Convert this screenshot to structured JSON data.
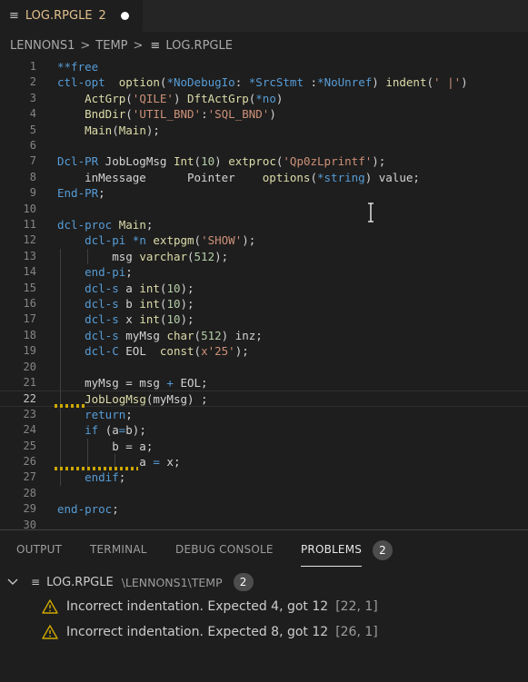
{
  "tab": {
    "icon": "menu-lines-icon",
    "name": "LOG.RPGLE",
    "count": "2",
    "unsaved_dot": "modified-dot-icon"
  },
  "breadcrumb": {
    "parts": [
      "LENNONS1",
      "TEMP",
      "LOG.RPGLE"
    ],
    "separator": ">"
  },
  "editor": {
    "current_line": 22,
    "lines": [
      {
        "num": "1",
        "tokens": [
          [
            "k",
            "**free"
          ]
        ]
      },
      {
        "num": "2",
        "tokens": [
          [
            "k",
            "ctl-opt"
          ],
          [
            "c",
            "  "
          ],
          [
            "f",
            "option"
          ],
          [
            "c",
            "("
          ],
          [
            "k",
            "*NoDebugIo"
          ],
          [
            "c",
            ": "
          ],
          [
            "k",
            "*SrcStmt"
          ],
          [
            "c",
            " :"
          ],
          [
            "k",
            "*NoUnref"
          ],
          [
            "c",
            ") "
          ],
          [
            "f",
            "indent"
          ],
          [
            "c",
            "("
          ],
          [
            "s",
            "' |'"
          ],
          [
            "c",
            ")"
          ]
        ]
      },
      {
        "num": "3",
        "tokens": [
          [
            "c",
            "    "
          ],
          [
            "f",
            "ActGrp"
          ],
          [
            "c",
            "("
          ],
          [
            "s",
            "'QILE'"
          ],
          [
            "c",
            ") "
          ],
          [
            "f",
            "DftActGrp"
          ],
          [
            "c",
            "("
          ],
          [
            "k",
            "*no"
          ],
          [
            "c",
            ")"
          ]
        ]
      },
      {
        "num": "4",
        "tokens": [
          [
            "c",
            "    "
          ],
          [
            "f",
            "BndDir"
          ],
          [
            "c",
            "("
          ],
          [
            "s",
            "'UTIL_BND'"
          ],
          [
            "c",
            ":"
          ],
          [
            "s",
            "'SQL_BND'"
          ],
          [
            "c",
            ")"
          ]
        ]
      },
      {
        "num": "5",
        "tokens": [
          [
            "c",
            "    "
          ],
          [
            "f",
            "Main"
          ],
          [
            "c",
            "("
          ],
          [
            "f",
            "Main"
          ],
          [
            "c",
            ");"
          ]
        ]
      },
      {
        "num": "6",
        "tokens": []
      },
      {
        "num": "7",
        "tokens": [
          [
            "k",
            "Dcl-PR"
          ],
          [
            "c",
            " JobLogMsg "
          ],
          [
            "f",
            "Int"
          ],
          [
            "c",
            "("
          ],
          [
            "n",
            "10"
          ],
          [
            "c",
            ") "
          ],
          [
            "f",
            "extproc"
          ],
          [
            "c",
            "("
          ],
          [
            "s",
            "'Qp0zLprintf'"
          ],
          [
            "c",
            ");"
          ]
        ]
      },
      {
        "num": "8",
        "tokens": [
          [
            "c",
            "    inMessage      Pointer    "
          ],
          [
            "f",
            "options"
          ],
          [
            "c",
            "("
          ],
          [
            "k",
            "*string"
          ],
          [
            "c",
            ") value;"
          ]
        ]
      },
      {
        "num": "9",
        "tokens": [
          [
            "k",
            "End-PR"
          ],
          [
            "c",
            ";"
          ]
        ]
      },
      {
        "num": "10",
        "tokens": []
      },
      {
        "num": "11",
        "tokens": [
          [
            "k",
            "dcl-proc"
          ],
          [
            "c",
            " "
          ],
          [
            "f",
            "Main"
          ],
          [
            "c",
            ";"
          ]
        ]
      },
      {
        "num": "12",
        "tokens": [
          [
            "c",
            "    "
          ],
          [
            "k",
            "dcl-pi"
          ],
          [
            "c",
            " "
          ],
          [
            "k",
            "*n"
          ],
          [
            "c",
            " "
          ],
          [
            "f",
            "extpgm"
          ],
          [
            "c",
            "("
          ],
          [
            "s",
            "'SHOW'"
          ],
          [
            "c",
            ");"
          ]
        ]
      },
      {
        "num": "13",
        "tokens": [
          [
            "c",
            "        msg "
          ],
          [
            "f",
            "varchar"
          ],
          [
            "c",
            "("
          ],
          [
            "n",
            "512"
          ],
          [
            "c",
            ");"
          ]
        ]
      },
      {
        "num": "14",
        "tokens": [
          [
            "c",
            "    "
          ],
          [
            "k",
            "end-pi"
          ],
          [
            "c",
            ";"
          ]
        ]
      },
      {
        "num": "15",
        "tokens": [
          [
            "c",
            "    "
          ],
          [
            "k",
            "dcl-s"
          ],
          [
            "c",
            " a "
          ],
          [
            "f",
            "int"
          ],
          [
            "c",
            "("
          ],
          [
            "n",
            "10"
          ],
          [
            "c",
            ");"
          ]
        ]
      },
      {
        "num": "16",
        "tokens": [
          [
            "c",
            "    "
          ],
          [
            "k",
            "dcl-s"
          ],
          [
            "c",
            " b "
          ],
          [
            "f",
            "int"
          ],
          [
            "c",
            "("
          ],
          [
            "n",
            "10"
          ],
          [
            "c",
            ");"
          ]
        ]
      },
      {
        "num": "17",
        "tokens": [
          [
            "c",
            "    "
          ],
          [
            "k",
            "dcl-s"
          ],
          [
            "c",
            " x "
          ],
          [
            "f",
            "int"
          ],
          [
            "c",
            "("
          ],
          [
            "n",
            "10"
          ],
          [
            "c",
            ");"
          ]
        ]
      },
      {
        "num": "18",
        "tokens": [
          [
            "c",
            "    "
          ],
          [
            "k",
            "dcl-s"
          ],
          [
            "c",
            " myMsg "
          ],
          [
            "f",
            "char"
          ],
          [
            "c",
            "("
          ],
          [
            "n",
            "512"
          ],
          [
            "c",
            ") inz;"
          ]
        ]
      },
      {
        "num": "19",
        "tokens": [
          [
            "c",
            "    "
          ],
          [
            "k",
            "dcl-C"
          ],
          [
            "c",
            " EOL  "
          ],
          [
            "f",
            "const"
          ],
          [
            "c",
            "("
          ],
          [
            "s",
            "x'25'"
          ],
          [
            "c",
            ");"
          ]
        ]
      },
      {
        "num": "20",
        "tokens": []
      },
      {
        "num": "21",
        "tokens": [
          [
            "c",
            "    myMsg = msg "
          ],
          [
            "k",
            "+"
          ],
          [
            "c",
            " EOL;"
          ]
        ]
      },
      {
        "num": "22",
        "tokens": [
          [
            "c",
            "    "
          ],
          [
            "f",
            "JobLogMsg"
          ],
          [
            "c",
            "(myMsg) ;"
          ]
        ]
      },
      {
        "num": "23",
        "tokens": [
          [
            "c",
            "    "
          ],
          [
            "k",
            "return"
          ],
          [
            "c",
            ";"
          ]
        ]
      },
      {
        "num": "24",
        "tokens": [
          [
            "c",
            "    "
          ],
          [
            "k",
            "if"
          ],
          [
            "c",
            " (a"
          ],
          [
            "k",
            "="
          ],
          [
            "c",
            "b);"
          ]
        ]
      },
      {
        "num": "25",
        "tokens": [
          [
            "c",
            "        b = a;"
          ]
        ]
      },
      {
        "num": "26",
        "tokens": [
          [
            "c",
            "            a "
          ],
          [
            "k",
            "="
          ],
          [
            "c",
            " x;"
          ]
        ]
      },
      {
        "num": "27",
        "tokens": [
          [
            "c",
            "    "
          ],
          [
            "k",
            "endif"
          ],
          [
            "c",
            ";"
          ]
        ]
      },
      {
        "num": "28",
        "tokens": []
      },
      {
        "num": "29",
        "tokens": [
          [
            "k",
            "end-proc"
          ],
          [
            "c",
            ";"
          ]
        ]
      },
      {
        "num": "30",
        "tokens": []
      }
    ]
  },
  "panel": {
    "tabs": [
      "OUTPUT",
      "TERMINAL",
      "DEBUG CONSOLE",
      "PROBLEMS"
    ],
    "active_tab": "PROBLEMS",
    "problems_count": "2",
    "file": {
      "name": "LOG.RPGLE",
      "path": "\\LENNONS1\\TEMP",
      "count": "2"
    },
    "problems": [
      {
        "message": "Incorrect indentation. Expected 4, got 12",
        "location": "[22, 1]"
      },
      {
        "message": "Incorrect indentation. Expected 8, got 12",
        "location": "[26, 1]"
      }
    ]
  },
  "colors": {
    "keyword": "#569cd6",
    "string": "#ce9178",
    "number": "#b5cea8",
    "function": "#dcdcaa",
    "warning": "#cca700",
    "modified": "#e2c08d"
  }
}
